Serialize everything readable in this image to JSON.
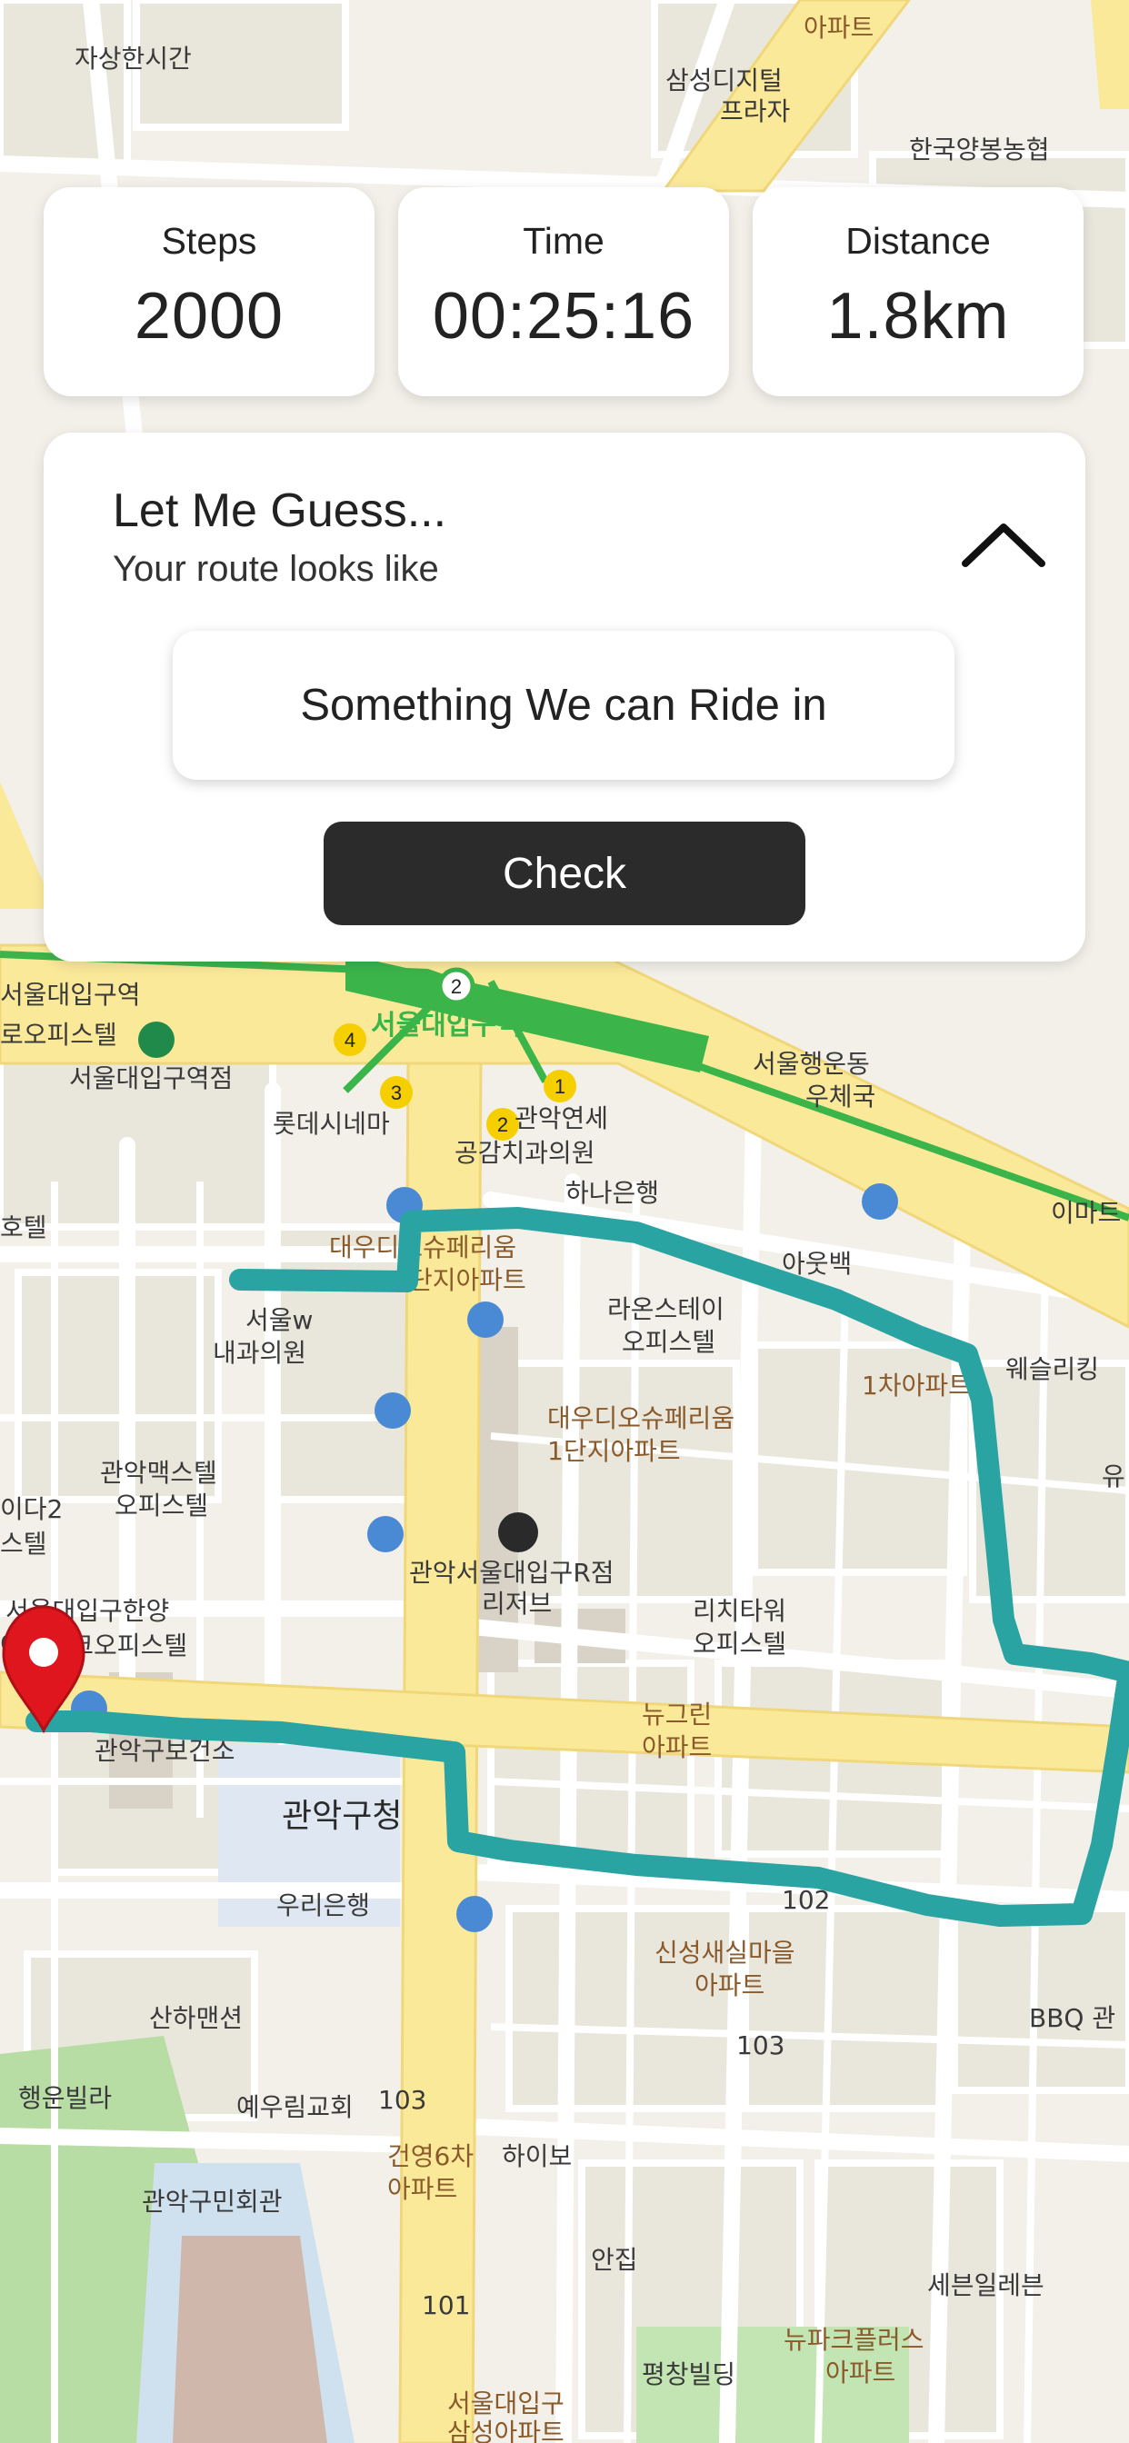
{
  "stats": {
    "steps": {
      "label": "Steps",
      "value": "2000"
    },
    "time": {
      "label": "Time",
      "value": "00:25:16"
    },
    "distance": {
      "label": "Distance",
      "value": "1.8km"
    }
  },
  "guess": {
    "title": "Let Me Guess...",
    "subtitle": "Your route looks like",
    "answer": "Something We can Ride in",
    "check_label": "Check"
  },
  "icons": {
    "collapse": "chevron-up-icon",
    "start_marker": "location-pin-icon"
  },
  "colors": {
    "route": "#2aa3a3",
    "pin": "#e0161f",
    "button": "#2b2b2b",
    "road_main": "#fbe99a",
    "subway_line": "#3bb54a"
  },
  "map": {
    "labels": {
      "l1": "자상한시간",
      "l2": "삼성디지털",
      "l3": "프라자",
      "l4": "한국양봉농협",
      "l5": "아파트",
      "l6": "서울대입구역",
      "l7": "서울대입구역점",
      "l8": "롯데시네마",
      "l9": "서울행운동",
      "l10": "우체국",
      "l11": "관악연세",
      "l12": "공감치과의원",
      "l13": "하나은행",
      "l14": "대우디오슈페리움",
      "l15": "단지아파트",
      "l16": "아웃백",
      "l17": "라온스테이",
      "l18": "오피스텔",
      "l19": "서울w",
      "l20": "내과의원",
      "l21": "1차아파트",
      "l22": "웨슬리킹",
      "l23": "대우디오슈페리움",
      "l24": "1단지아파트",
      "l25": "관악맥스텔",
      "l26": "오피스텔",
      "l27": "관악서울대입구R점",
      "l28": "리저브",
      "l29": "리치타워",
      "l30": "오피스텔",
      "l31": "서울대입구한양",
      "l32": "아이파크오피스텔",
      "l33": "뉴그린",
      "l34": "아파트",
      "l35": "관악구청",
      "l36": "우리은행",
      "l37": "신성새실마을",
      "l38": "아파트",
      "l39": "산하맨션",
      "l40": "행운빌라",
      "l41": "예우림교회",
      "l42": "건영6차",
      "l43": "아파트",
      "l44": "하이보",
      "l45": "관악구민회관",
      "l46": "안집",
      "l47": "세븐일레븐",
      "l48": "뉴파크플러스",
      "l49": "아파트",
      "l50": "평창빌딩",
      "l51": "서울대입구",
      "l52": "삼성아파트",
      "l53": "BBQ 관",
      "l54": "이마트",
      "l55": "유",
      "l56": "서울대입구역",
      "l57": "로오피스텔",
      "l58": "호텔",
      "l59": "이다2",
      "l60": "스텔",
      "l61": "102",
      "l62": "103",
      "l63": "103",
      "l64": "101",
      "l65": "관악구보건소"
    }
  }
}
